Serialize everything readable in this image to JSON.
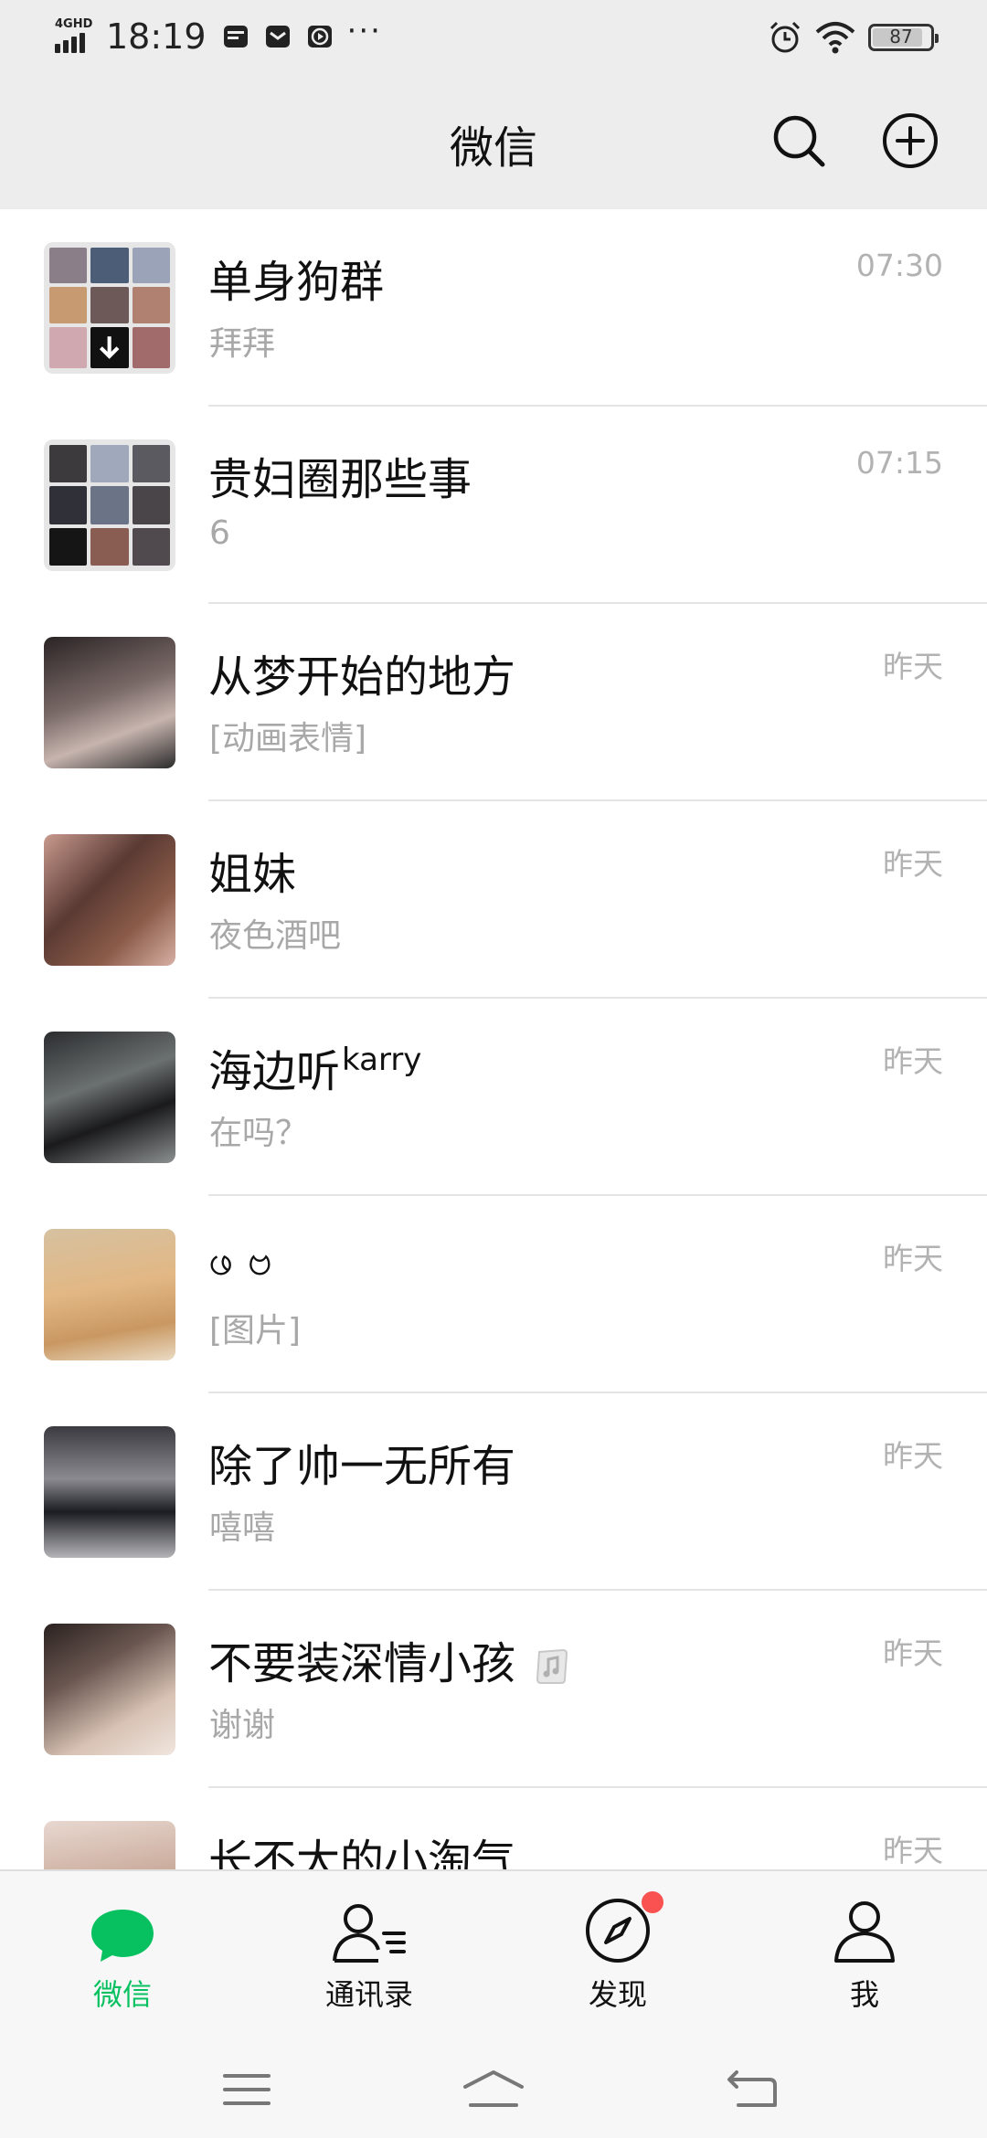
{
  "status_bar": {
    "network": "4GHD",
    "time": "18:19",
    "more": "···",
    "battery": "87",
    "battery_level": 0.87
  },
  "header": {
    "title": "微信"
  },
  "chats": [
    {
      "name": "单身狗群",
      "name_sup": "",
      "preview": "拜拜",
      "time": "07:30",
      "music": false
    },
    {
      "name": "贵妇圈那些事",
      "name_sup": "",
      "preview": "6",
      "time": "07:15",
      "music": false
    },
    {
      "name": "从梦开始的地方",
      "name_sup": "",
      "preview": "[动画表情]",
      "time": "昨天",
      "music": false
    },
    {
      "name": "姐妹",
      "name_sup": "",
      "preview": "夜色酒吧",
      "time": "昨天",
      "music": false
    },
    {
      "name": "海边听",
      "name_sup": "karry",
      "preview": "在吗？",
      "time": "昨天",
      "music": false
    },
    {
      "name": "ဖ ဗ",
      "name_sup": "",
      "preview": "[图片]",
      "time": "昨天",
      "music": false
    },
    {
      "name": "除了帅一无所有",
      "name_sup": "",
      "preview": "嘻嘻",
      "time": "昨天",
      "music": false
    },
    {
      "name": "不要装深情小孩",
      "name_sup": "",
      "preview": "谢谢",
      "time": "昨天",
      "music": true
    },
    {
      "name": "长不大的小淘气",
      "name_sup": "",
      "preview": "",
      "time": "昨天",
      "music": false
    }
  ],
  "tabs": [
    {
      "label": "微信",
      "icon": "chat-bubble-icon",
      "active": true
    },
    {
      "label": "通讯录",
      "icon": "contacts-icon",
      "active": false
    },
    {
      "label": "发现",
      "icon": "compass-icon",
      "active": false,
      "badge": true
    },
    {
      "label": "我",
      "icon": "person-icon",
      "active": false
    }
  ],
  "colors": {
    "accent": "#07c160",
    "badge": "#fa5151",
    "header_bg": "#ededed"
  }
}
